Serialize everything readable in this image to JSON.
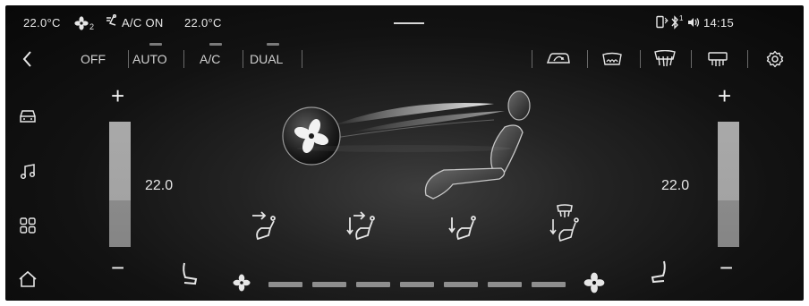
{
  "status_bar": {
    "left_temp": "22.0°C",
    "fan_level": "2",
    "ac_status": "A/C ON",
    "right_temp": "22.0°C",
    "bluetooth_level": "1",
    "time": "14:15"
  },
  "modes": [
    "OFF",
    "AUTO",
    "A/C",
    "DUAL"
  ],
  "left_zone": {
    "temp": "22.0",
    "plus": "+",
    "minus": "−"
  },
  "right_zone": {
    "temp": "22.0",
    "plus": "+",
    "minus": "−"
  },
  "fan_speed": {
    "segments": 7
  },
  "colors": {
    "background": "#111111",
    "slider": "#a5a5a5",
    "fan_segment": "#8e8e8e"
  }
}
